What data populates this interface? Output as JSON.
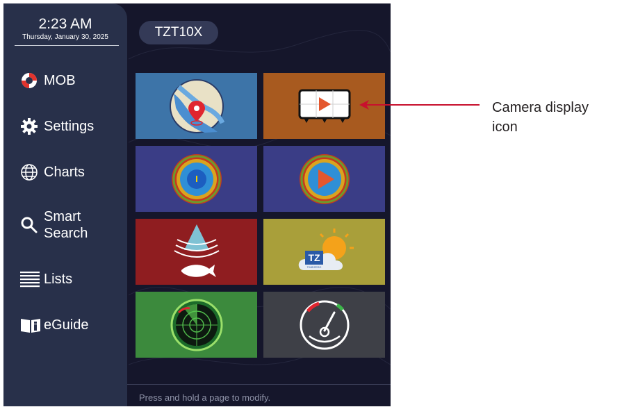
{
  "status": {
    "time": "2:23 AM",
    "date": "Thursday, January 30, 2025"
  },
  "sidebar": {
    "items": [
      {
        "label": "MOB",
        "icon": "lifebuoy-icon"
      },
      {
        "label": "Settings",
        "icon": "gear-icon"
      },
      {
        "label": "Charts",
        "icon": "globe-icon"
      },
      {
        "label": "Smart",
        "label2": "Search",
        "icon": "search-icon"
      },
      {
        "label": "Lists",
        "icon": "list-icon"
      },
      {
        "label": "eGuide",
        "icon": "book-icon"
      }
    ]
  },
  "header": {
    "model": "TZT10X"
  },
  "tiles": [
    {
      "name": "chart-plotter-tile",
      "icon": "nautical-chart-icon",
      "bg": "#3d74a8"
    },
    {
      "name": "camera-display-tile",
      "icon": "camera-display-icon",
      "bg": "#a85a1f"
    },
    {
      "name": "fish-finder-accu-tile",
      "icon": "accufish-icon",
      "bg": "#3a3d86"
    },
    {
      "name": "fish-finder-video-tile",
      "icon": "fish-finder-video-icon",
      "bg": "#3a3d86"
    },
    {
      "name": "sonar-tile",
      "icon": "fish-sonar-icon",
      "bg": "#8f1d20"
    },
    {
      "name": "timezero-weather-tile",
      "icon": "timezero-weather-icon",
      "bg": "#a99f3a",
      "logo_text": "TZ",
      "logo_sub": "TIMEZERO"
    },
    {
      "name": "radar-tile",
      "icon": "radar-icon",
      "bg": "#3c8a3d"
    },
    {
      "name": "instruments-tile",
      "icon": "gauge-icon",
      "bg": "#3e4047"
    }
  ],
  "footer": {
    "hint": "Press and hold a page to modify."
  },
  "callout": {
    "line1": "Camera display",
    "line2": "icon",
    "arrow_color": "#c8102e"
  }
}
